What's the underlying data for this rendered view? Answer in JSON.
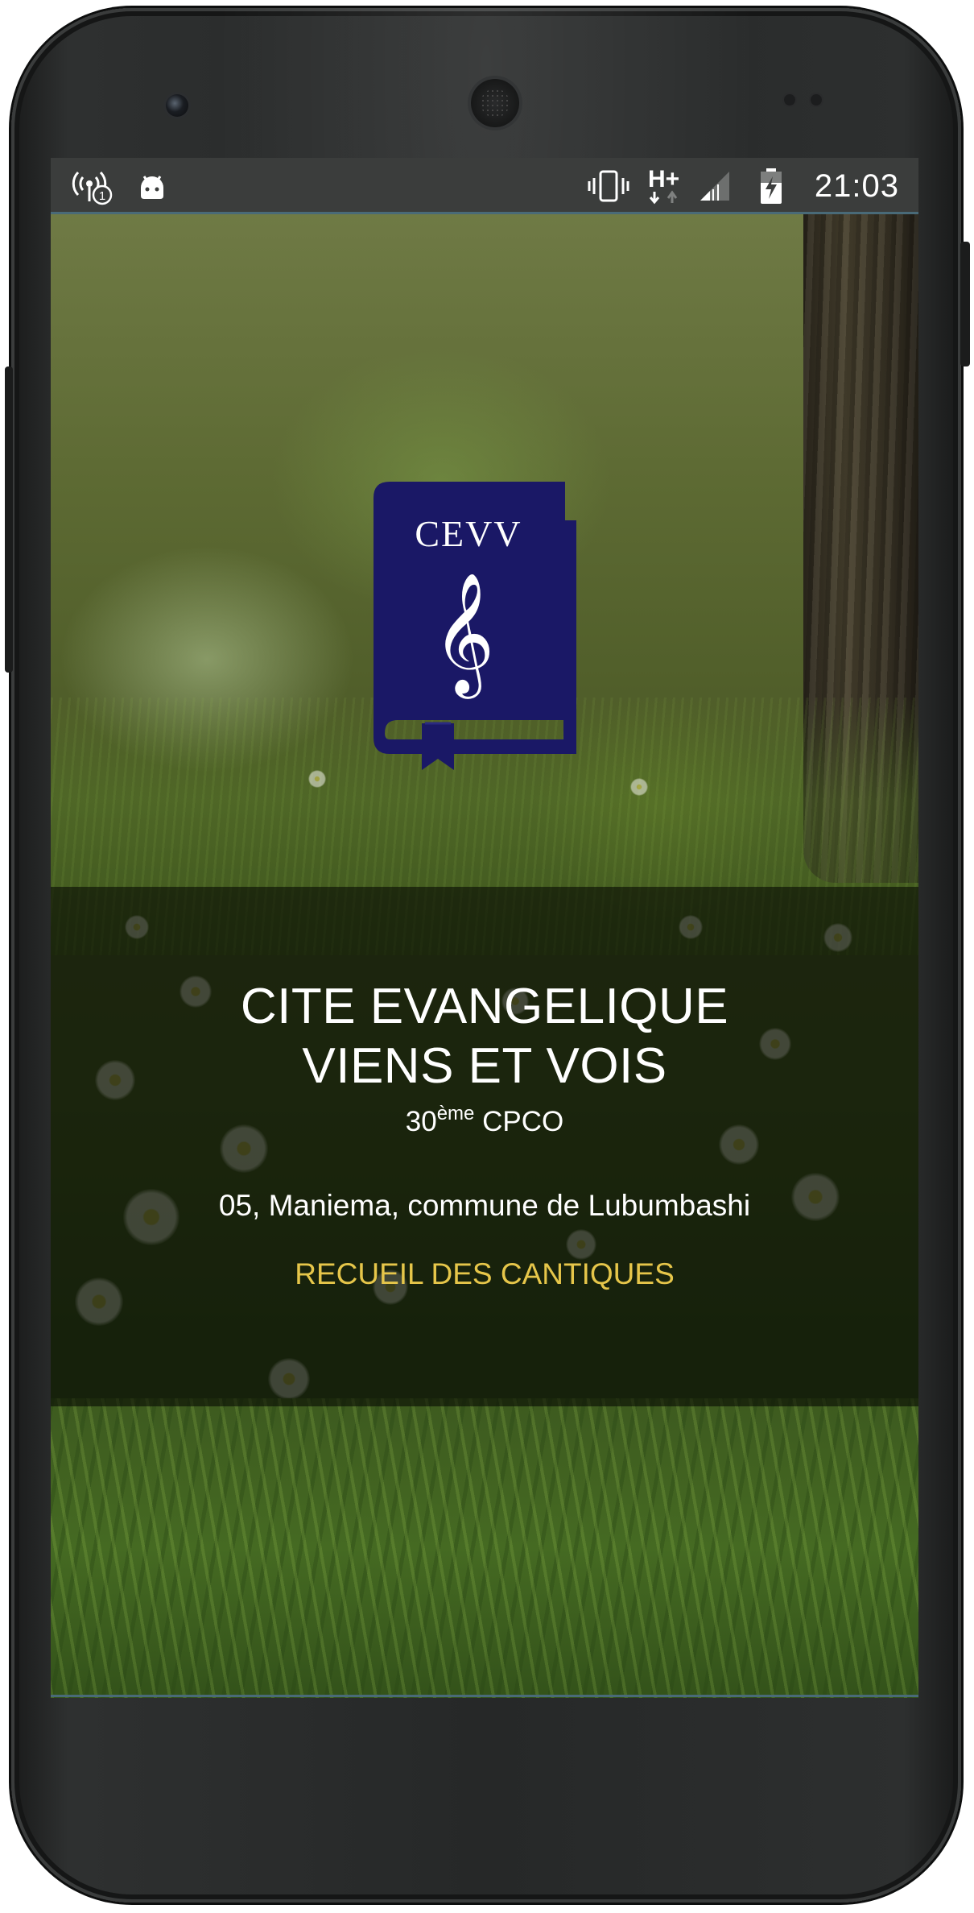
{
  "status_bar": {
    "time": "21:03",
    "network_type": "H+",
    "icons": [
      "wifi-hotspot-icon",
      "android-debug-icon",
      "vibrate-icon",
      "network-hplus-icon",
      "signal-icon",
      "battery-charging-icon"
    ],
    "notification_count": "1"
  },
  "logo": {
    "book_label": "CEVV",
    "symbol": "𝄞",
    "book_color": "#1a1866"
  },
  "church": {
    "name_line1": "CITE EVANGELIQUE",
    "name_line2": "VIENS ET VOIS",
    "number": "30",
    "number_suffix": "ème",
    "assembly": "CPCO",
    "address": "05, Maniema, commune de Lubumbashi"
  },
  "actions": {
    "hymnal_link": "RECUEIL DES CANTIQUES"
  },
  "colors": {
    "link": "#e6c64a",
    "status_bar": "#3b3d3c",
    "screen_edge": "#496a78"
  }
}
